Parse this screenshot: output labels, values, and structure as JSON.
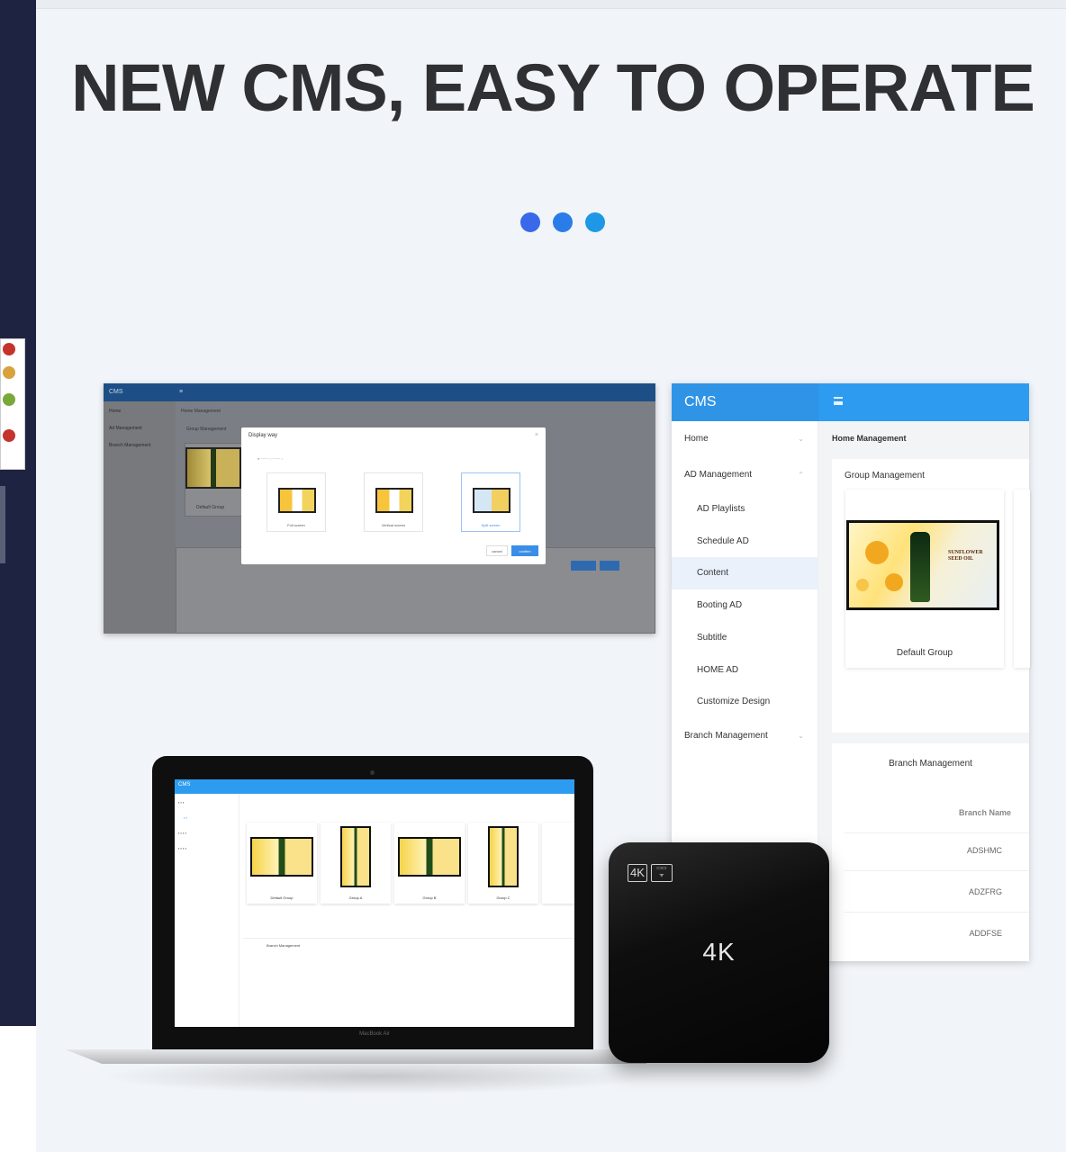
{
  "headline": "NEW CMS, EASY TO OPERATE",
  "dot_colors": [
    "#3a68ea",
    "#2a7ce8",
    "#1e98e6"
  ],
  "desktop": {
    "brand": "CMS",
    "menu_icon": "≡",
    "side_items": [
      "Home",
      "Ad Management",
      "Branch Management"
    ],
    "crumb": "Home Management",
    "group_title": "Group Management",
    "card_caption": "Default Group",
    "modal": {
      "title": "Display way",
      "options": [
        "Full screen",
        "Vertical screen",
        "Split screen"
      ],
      "cancel": "cancel",
      "confirm": "confirm"
    }
  },
  "tablet": {
    "brand": "CMS",
    "sidebar": [
      {
        "label": "Home",
        "level": "top",
        "chevron": "⌄"
      },
      {
        "label": "AD Management",
        "level": "top",
        "chevron": "⌃"
      },
      {
        "label": "AD Playlists",
        "level": "sub"
      },
      {
        "label": "Schedule AD",
        "level": "sub"
      },
      {
        "label": "Content",
        "level": "sub",
        "active": true
      },
      {
        "label": "Booting AD",
        "level": "sub"
      },
      {
        "label": "Subtitle",
        "level": "sub"
      },
      {
        "label": "HOME AD",
        "level": "sub"
      },
      {
        "label": "Customize Design",
        "level": "sub"
      },
      {
        "label": "Branch Management",
        "level": "top",
        "chevron": "⌄"
      }
    ],
    "breadcrumb": "Home Management",
    "group_title": "Group Management",
    "tv_brand": "SUNFLOWER SEED OIL",
    "card_caption": "Default Group",
    "branch_title": "Branch Management",
    "branch_col": "Branch Name",
    "branch_rows": [
      "ADSHMC",
      "ADZFRG",
      "ADDFSE"
    ]
  },
  "laptop": {
    "brand": "CMS",
    "model": "MacBook Air",
    "groups": [
      "Default Group",
      "Group A",
      "Group B",
      "Group C"
    ],
    "branch_title": "Branch Management"
  },
  "box": {
    "badge": "4K",
    "label": "4K"
  }
}
